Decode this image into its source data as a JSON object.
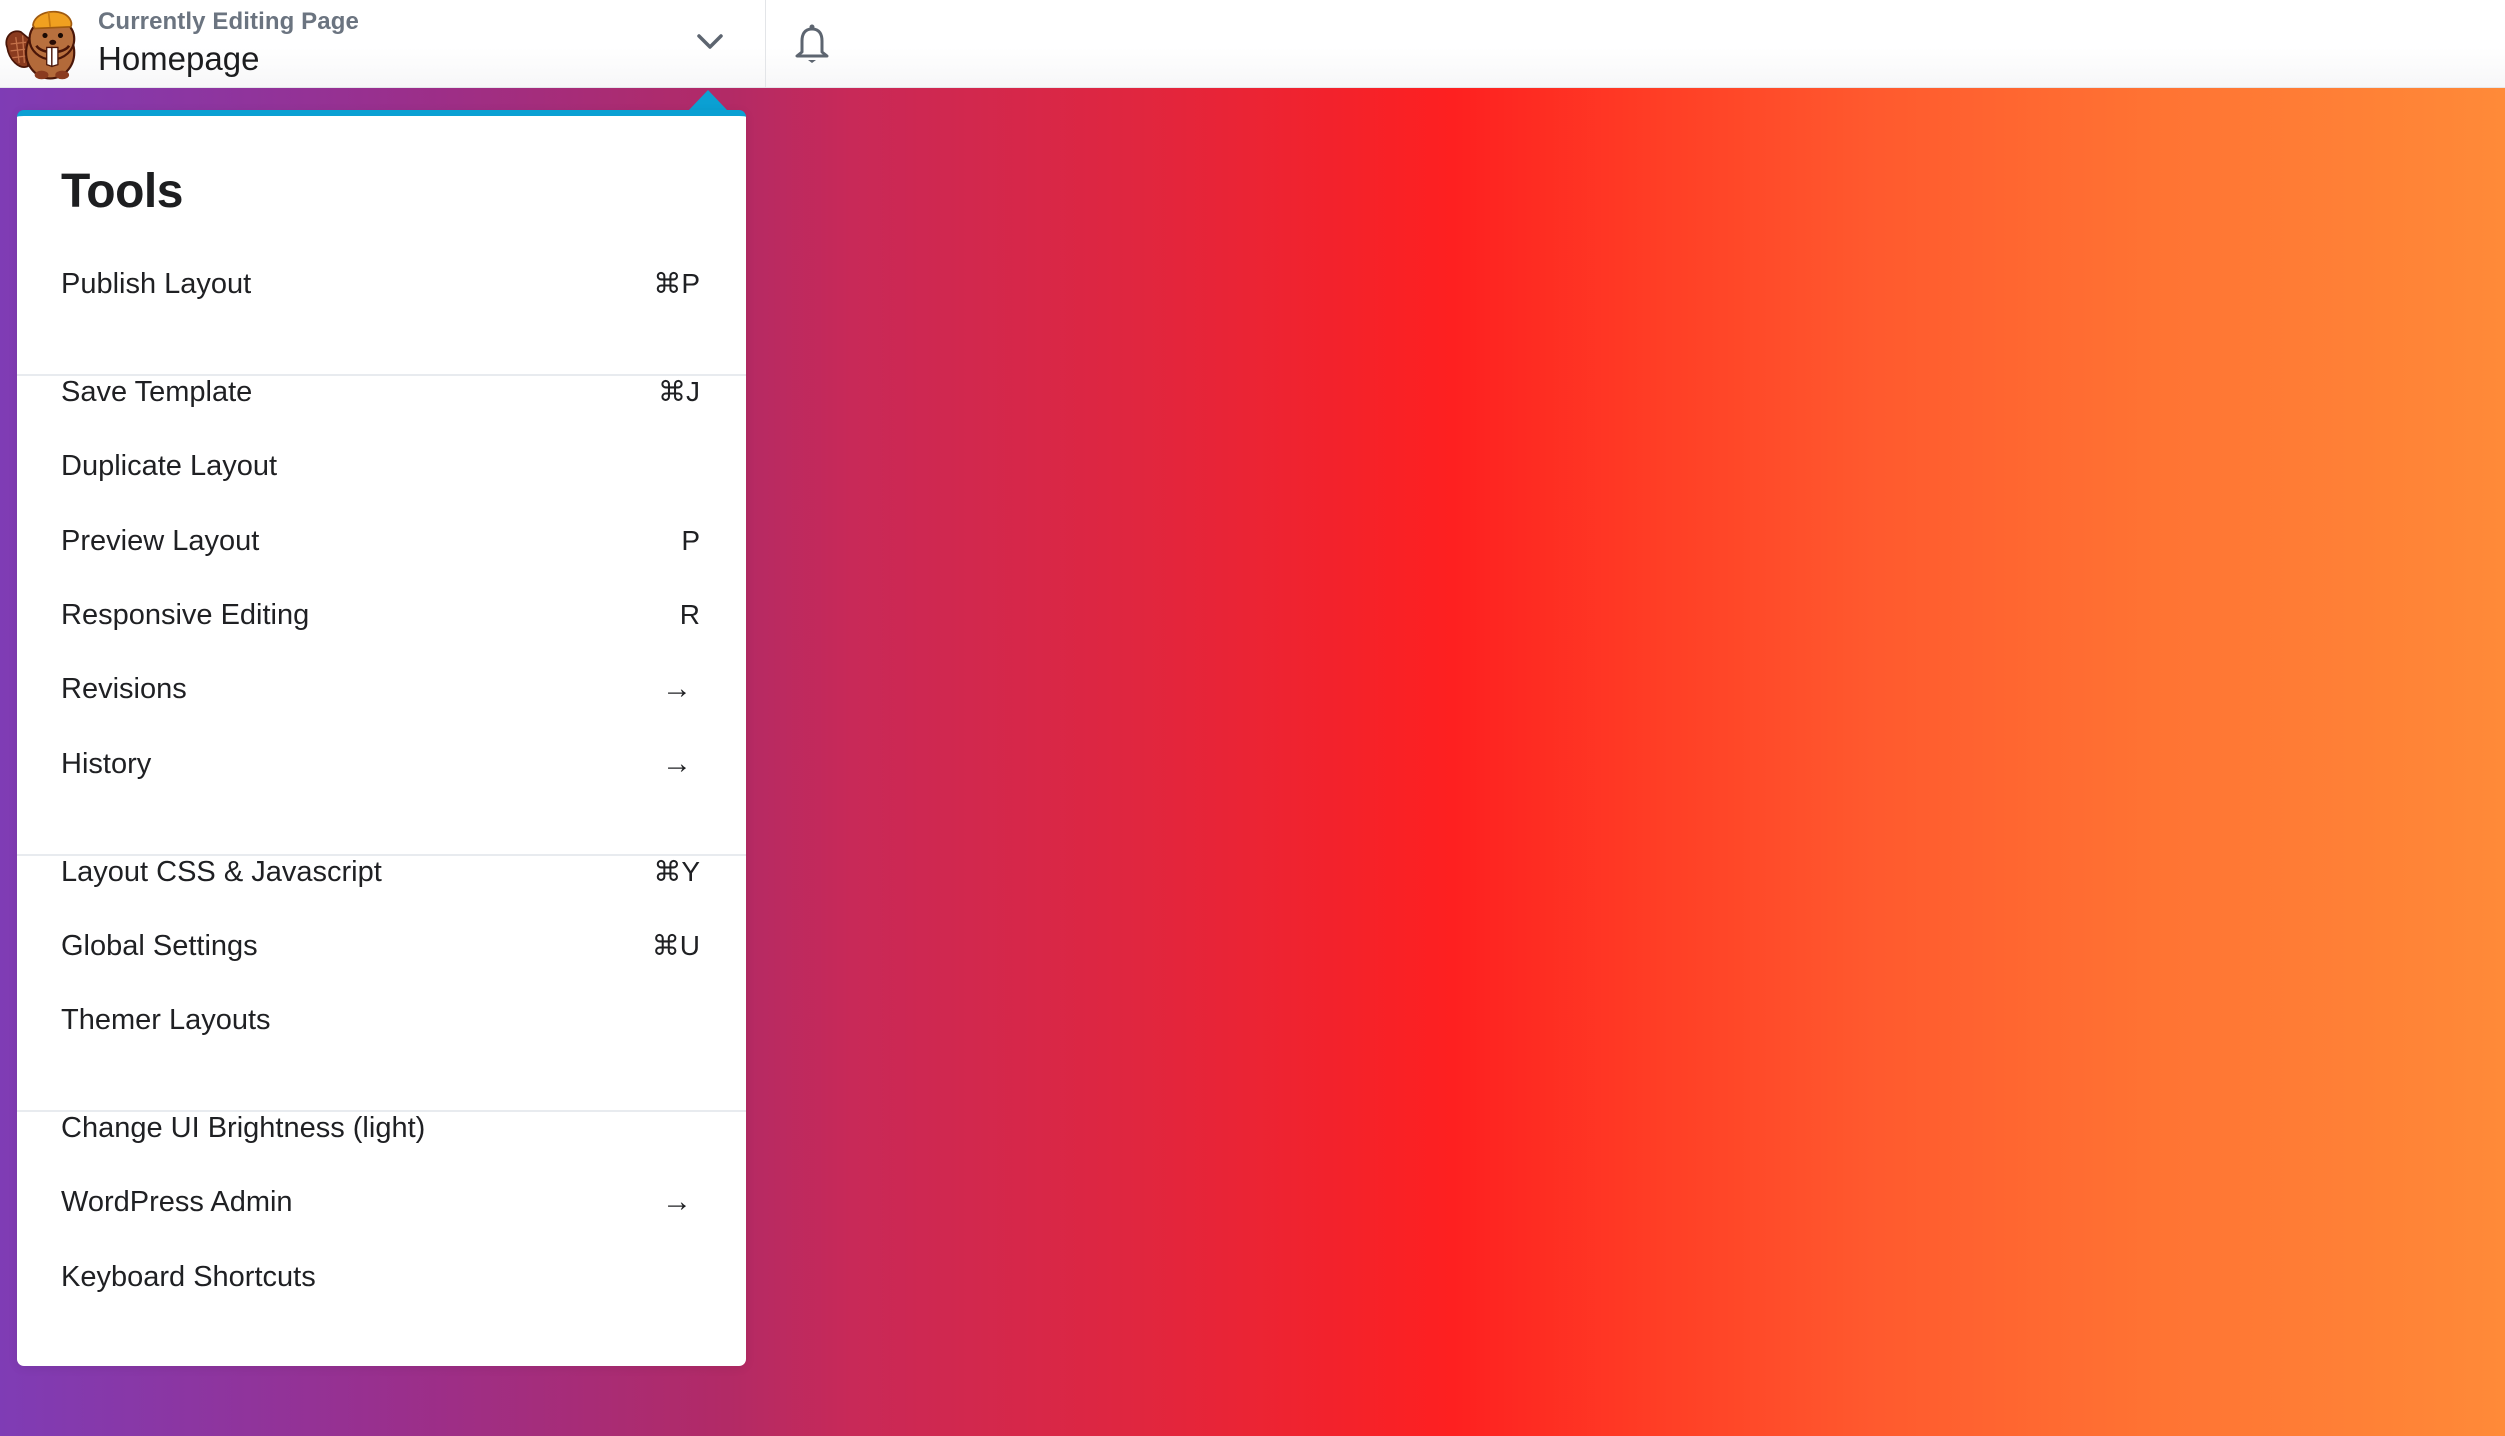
{
  "header": {
    "kicker": "Currently Editing Page",
    "page_name": "Homepage",
    "logo_icon": "beaver-mascot-logo",
    "dropdown_icon": "chevron-down-icon",
    "notifications_icon": "bell-icon"
  },
  "tools_panel": {
    "title": "Tools",
    "accent_color": "#0ba0d3",
    "groups": [
      [
        {
          "label": "Publish Layout",
          "shortcut": "⌘P"
        }
      ],
      [
        {
          "label": "Save Template",
          "shortcut": "⌘J"
        },
        {
          "label": "Duplicate Layout",
          "shortcut": ""
        },
        {
          "label": "Preview Layout",
          "shortcut": "P"
        },
        {
          "label": "Responsive Editing",
          "shortcut": "R"
        },
        {
          "label": "Revisions",
          "shortcut": "→"
        },
        {
          "label": "History",
          "shortcut": "→"
        }
      ],
      [
        {
          "label": "Layout CSS & Javascript",
          "shortcut": "⌘Y"
        },
        {
          "label": "Global Settings",
          "shortcut": "⌘U"
        },
        {
          "label": "Themer Layouts",
          "shortcut": ""
        }
      ],
      [
        {
          "label": "Change UI Brightness (light)",
          "shortcut": ""
        },
        {
          "label": "WordPress Admin",
          "shortcut": "→"
        },
        {
          "label": "Keyboard Shortcuts",
          "shortcut": ""
        }
      ]
    ]
  },
  "background": {
    "gradient_colors": [
      "#7f3cb5",
      "#b22a66",
      "#fe2020",
      "#ff8a38"
    ]
  }
}
